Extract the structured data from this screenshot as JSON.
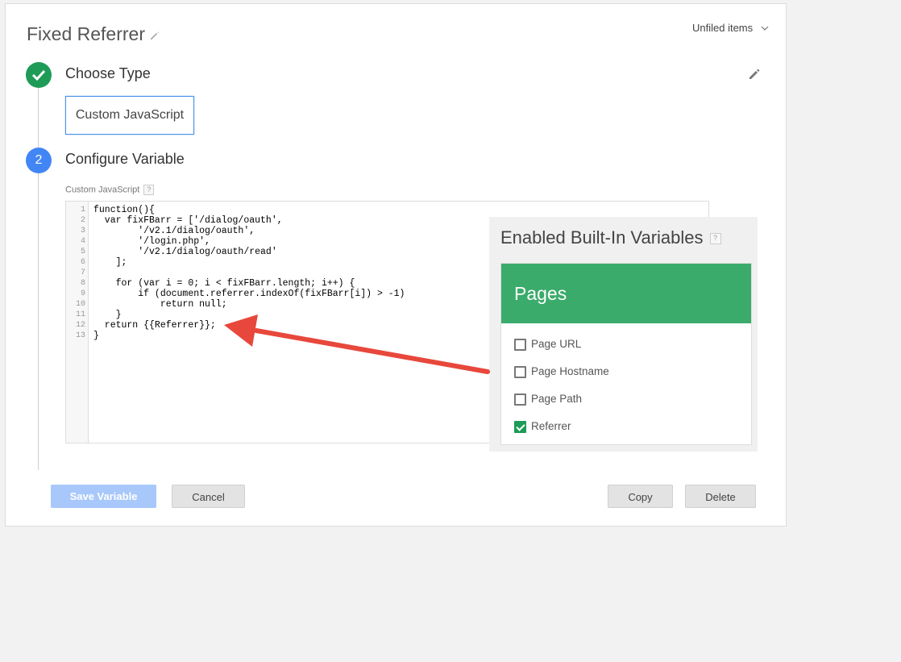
{
  "header": {
    "title": "Fixed Referrer",
    "folder_label": "Unfiled items"
  },
  "steps": {
    "choose_type": {
      "label": "Choose Type",
      "value": "Custom JavaScript"
    },
    "configure": {
      "number": "2",
      "label": "Configure Variable"
    }
  },
  "editor": {
    "label": "Custom JavaScript",
    "help": "?",
    "line_numbers": [
      "1",
      "2",
      "3",
      "4",
      "5",
      "6",
      "7",
      "8",
      "9",
      "10",
      "11",
      "12",
      "13"
    ],
    "lines": [
      "function(){",
      "  var fixFBarr = ['/dialog/oauth',",
      "        '/v2.1/dialog/oauth',",
      "        '/login.php',",
      "        '/v2.1/dialog/oauth/read'",
      "    ];",
      "",
      "    for (var i = 0; i < fixFBarr.length; i++) {",
      "        if (document.referrer.indexOf(fixFBarr[i]) > -1)",
      "            return null;",
      "    }",
      "  return {{Referrer}};",
      "}"
    ]
  },
  "builtin_vars": {
    "title": "Enabled Built-In Variables",
    "help": "?",
    "group": "Pages",
    "items": [
      {
        "label": "Page URL",
        "checked": false
      },
      {
        "label": "Page Hostname",
        "checked": false
      },
      {
        "label": "Page Path",
        "checked": false
      },
      {
        "label": "Referrer",
        "checked": true
      }
    ]
  },
  "buttons": {
    "save": "Save Variable",
    "cancel": "Cancel",
    "copy": "Copy",
    "delete": "Delete"
  },
  "colors": {
    "accent_blue": "#4285f4",
    "success_green": "#1e9b57",
    "pages_header": "#3aab6b",
    "arrow_red": "#e8473b"
  }
}
